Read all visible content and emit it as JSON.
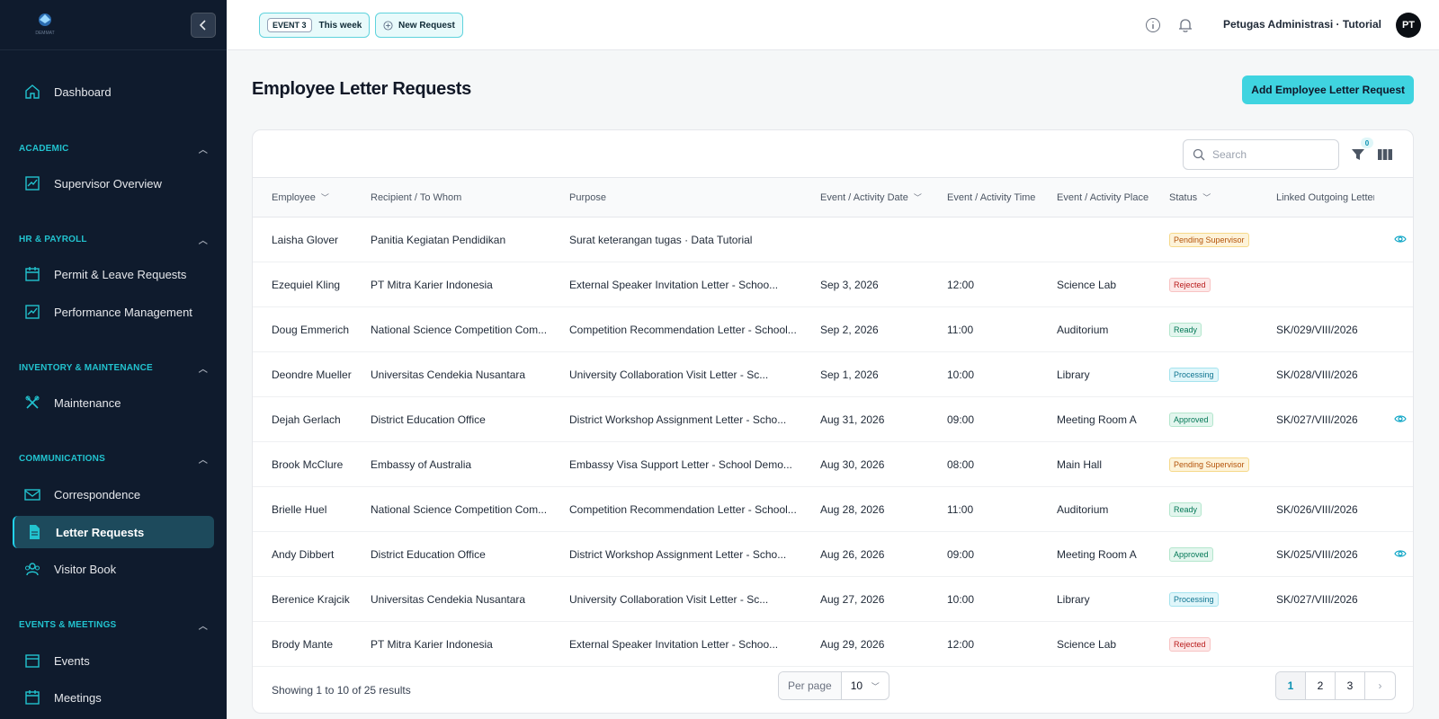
{
  "sidebar": {
    "logo_text": "DEMMAT",
    "dashboard": "Dashboard",
    "sections": [
      {
        "title": "ACADEMIC",
        "items": [
          "Supervisor Overview"
        ]
      },
      {
        "title": "HR & PAYROLL",
        "items": [
          "Permit & Leave Requests",
          "Performance Management"
        ]
      },
      {
        "title": "INVENTORY & MAINTENANCE",
        "items": [
          "Maintenance"
        ]
      },
      {
        "title": "COMMUNICATIONS",
        "items": [
          "Correspondence",
          "Letter Requests",
          "Visitor Book"
        ]
      },
      {
        "title": "EVENTS & MEETINGS",
        "items": [
          "Events",
          "Meetings"
        ]
      }
    ],
    "active_item": "Letter Requests"
  },
  "topbar": {
    "event_badge": "EVENT 3",
    "event_period": "This week",
    "new_request": "New Request",
    "user_name": "Petugas Administrasi · Tutorial",
    "avatar_initials": "PT"
  },
  "page": {
    "title": "Employee Letter Requests",
    "add_button": "Add Employee Letter Request"
  },
  "toolbar": {
    "search_placeholder": "Search",
    "filter_count": "0"
  },
  "table": {
    "columns": [
      "Employee",
      "Recipient / To Whom",
      "Purpose",
      "Event / Activity Date",
      "Event / Activity Time",
      "Event / Activity Place",
      "Status",
      "Linked Outgoing Letter"
    ],
    "rows": [
      {
        "employee": "Laisha Glover",
        "recipient": "Panitia Kegiatan Pendidikan",
        "purpose": "Surat keterangan tugas · Data Tutorial",
        "date": "",
        "time": "",
        "place": "",
        "status": "Pending Supervisor",
        "status_kind": "pending",
        "letter": "",
        "view": true
      },
      {
        "employee": "Ezequiel Kling",
        "recipient": "PT Mitra Karier Indonesia",
        "purpose": "External Speaker Invitation Letter - Schoo...",
        "date": "Sep 3, 2026",
        "time": "12:00",
        "place": "Science Lab",
        "status": "Rejected",
        "status_kind": "rejected",
        "letter": "",
        "view": false
      },
      {
        "employee": "Doug Emmerich",
        "recipient": "National Science Competition Com...",
        "purpose": "Competition Recommendation Letter - School...",
        "date": "Sep 2, 2026",
        "time": "11:00",
        "place": "Auditorium",
        "status": "Ready",
        "status_kind": "ready",
        "letter": "SK/029/VIII/2026",
        "view": false
      },
      {
        "employee": "Deondre Mueller",
        "recipient": "Universitas Cendekia Nusantara",
        "purpose": "University Collaboration Visit Letter - Sc...",
        "date": "Sep 1, 2026",
        "time": "10:00",
        "place": "Library",
        "status": "Processing",
        "status_kind": "processing",
        "letter": "SK/028/VIII/2026",
        "view": false
      },
      {
        "employee": "Dejah Gerlach",
        "recipient": "District Education Office",
        "purpose": "District Workshop Assignment Letter - Scho...",
        "date": "Aug 31, 2026",
        "time": "09:00",
        "place": "Meeting Room A",
        "status": "Approved",
        "status_kind": "approved",
        "letter": "SK/027/VIII/2026",
        "view": true
      },
      {
        "employee": "Brook McClure",
        "recipient": "Embassy of Australia",
        "purpose": "Embassy Visa Support Letter - School Demo...",
        "date": "Aug 30, 2026",
        "time": "08:00",
        "place": "Main Hall",
        "status": "Pending Supervisor",
        "status_kind": "pending",
        "letter": "",
        "view": false
      },
      {
        "employee": "Brielle Huel",
        "recipient": "National Science Competition Com...",
        "purpose": "Competition Recommendation Letter - School...",
        "date": "Aug 28, 2026",
        "time": "11:00",
        "place": "Auditorium",
        "status": "Ready",
        "status_kind": "ready",
        "letter": "SK/026/VIII/2026",
        "view": false
      },
      {
        "employee": "Andy Dibbert",
        "recipient": "District Education Office",
        "purpose": "District Workshop Assignment Letter - Scho...",
        "date": "Aug 26, 2026",
        "time": "09:00",
        "place": "Meeting Room A",
        "status": "Approved",
        "status_kind": "approved",
        "letter": "SK/025/VIII/2026",
        "view": true
      },
      {
        "employee": "Berenice Krajcik",
        "recipient": "Universitas Cendekia Nusantara",
        "purpose": "University Collaboration Visit Letter - Sc...",
        "date": "Aug 27, 2026",
        "time": "10:00",
        "place": "Library",
        "status": "Processing",
        "status_kind": "processing",
        "letter": "SK/027/VIII/2026",
        "view": false
      },
      {
        "employee": "Brody Mante",
        "recipient": "PT Mitra Karier Indonesia",
        "purpose": "External Speaker Invitation Letter - Schoo...",
        "date": "Aug 29, 2026",
        "time": "12:00",
        "place": "Science Lab",
        "status": "Rejected",
        "status_kind": "rejected",
        "letter": "",
        "view": false
      }
    ]
  },
  "footer": {
    "showing": "Showing 1 to 10 of 25 results",
    "per_page_label": "Per page",
    "per_page_value": "10",
    "pages": [
      "1",
      "2",
      "3"
    ],
    "current_page": "1"
  },
  "colors": {
    "sidebar_bg": "#0f1b2d",
    "accent": "#3fd4e0",
    "section_title": "#22c3cf"
  }
}
